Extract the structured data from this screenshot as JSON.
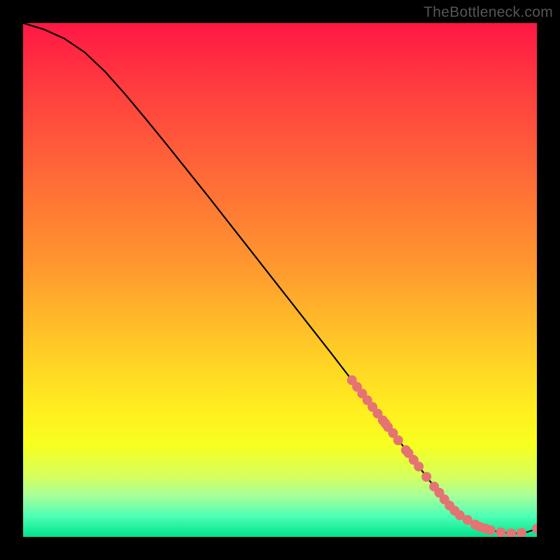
{
  "watermark": "TheBottleneck.com",
  "chart_data": {
    "type": "line",
    "title": "",
    "xlabel": "",
    "ylabel": "",
    "xlim": [
      0,
      100
    ],
    "ylim": [
      0,
      100
    ],
    "series": [
      {
        "name": "curve",
        "x": [
          0,
          4,
          8,
          12,
          16,
          20,
          24,
          28,
          32,
          36,
          40,
          44,
          48,
          52,
          56,
          60,
          64,
          68,
          72,
          76,
          80,
          82,
          84,
          86,
          88,
          90,
          92,
          94,
          96,
          98,
          100
        ],
        "y": [
          100,
          98.8,
          97.0,
          94.3,
          90.5,
          86.0,
          81.2,
          76.3,
          71.3,
          66.3,
          61.2,
          56.1,
          51.0,
          45.9,
          40.8,
          35.7,
          30.5,
          25.3,
          20.2,
          15.0,
          9.8,
          7.3,
          5.1,
          3.5,
          2.4,
          1.6,
          1.1,
          0.8,
          0.7,
          0.9,
          1.6
        ]
      }
    ],
    "markers": {
      "name": "highlighted-points",
      "x": [
        64,
        65,
        66,
        67,
        68,
        69,
        70,
        70.5,
        71,
        72,
        73,
        74.5,
        75,
        76,
        77,
        78.5,
        80,
        81,
        82,
        83,
        84,
        85,
        86.5,
        88,
        89,
        90,
        91,
        93,
        95,
        97,
        100
      ],
      "y": [
        30.5,
        29.2,
        27.9,
        26.6,
        25.3,
        24.0,
        22.7,
        22.1,
        21.4,
        20.2,
        18.8,
        16.9,
        16.3,
        15.0,
        13.7,
        11.7,
        9.8,
        8.6,
        7.3,
        6.1,
        5.1,
        4.2,
        3.3,
        2.4,
        1.9,
        1.6,
        1.3,
        0.9,
        0.7,
        0.8,
        1.6
      ]
    },
    "marker_color": "#e57373",
    "line_color": "#000000"
  }
}
